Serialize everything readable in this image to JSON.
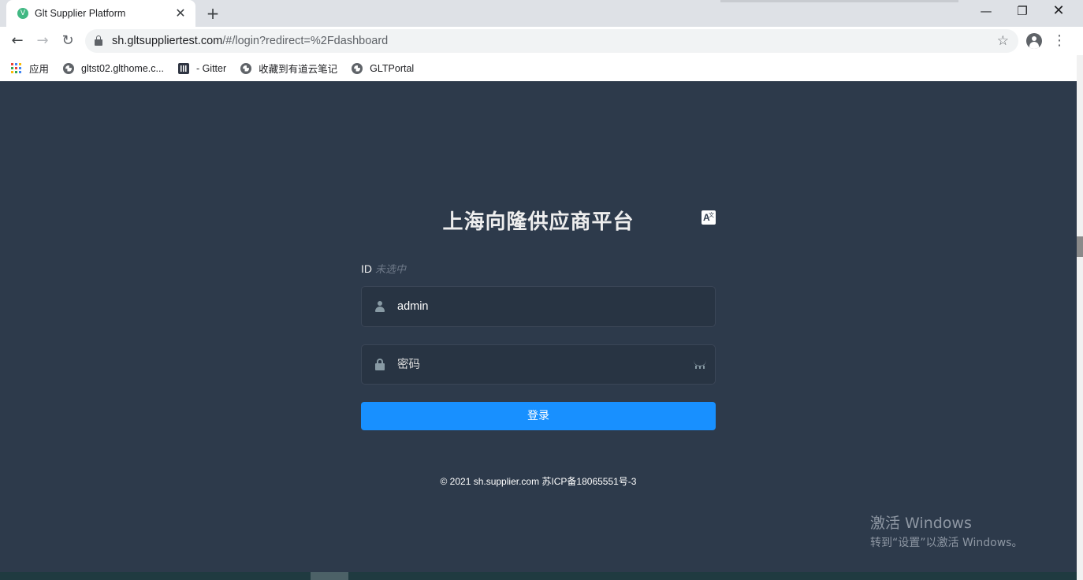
{
  "browser": {
    "tab_title": "Glt Supplier Platform",
    "tab_favicon": "V",
    "tab_close": "✕",
    "new_tab": "+",
    "url_host": "sh.gltsuppliertest.com",
    "url_path": "/#/login?redirect=%2Fdashboard",
    "window_min": "—",
    "window_max": "❐",
    "window_close": "✕",
    "back": "←",
    "forward": "→",
    "reload": "↻",
    "star": "☆",
    "menu": "⋮",
    "bookmarks": [
      {
        "label": "应用",
        "icon": "apps-icon"
      },
      {
        "label": "gltst02.glthome.c...",
        "icon": "globe-icon"
      },
      {
        "label": "- Gitter",
        "icon": "gitter-icon"
      },
      {
        "label": "收藏到有道云笔记",
        "icon": "globe-icon"
      },
      {
        "label": "GLTPortal",
        "icon": "globe-icon"
      }
    ]
  },
  "login": {
    "title": "上海向隆供应商平台",
    "lang_icon_text": "A",
    "lang_icon_sup": "文",
    "id_label": "ID",
    "id_hint": "未选中",
    "username_value": "admin",
    "password_placeholder": "密码",
    "submit_label": "登录",
    "footer": "© 2021 sh.supplier.com 苏ICP备18065551号-3"
  },
  "watermark": {
    "line1": "激活 Windows",
    "line2": "转到“设置”以激活 Windows。"
  }
}
